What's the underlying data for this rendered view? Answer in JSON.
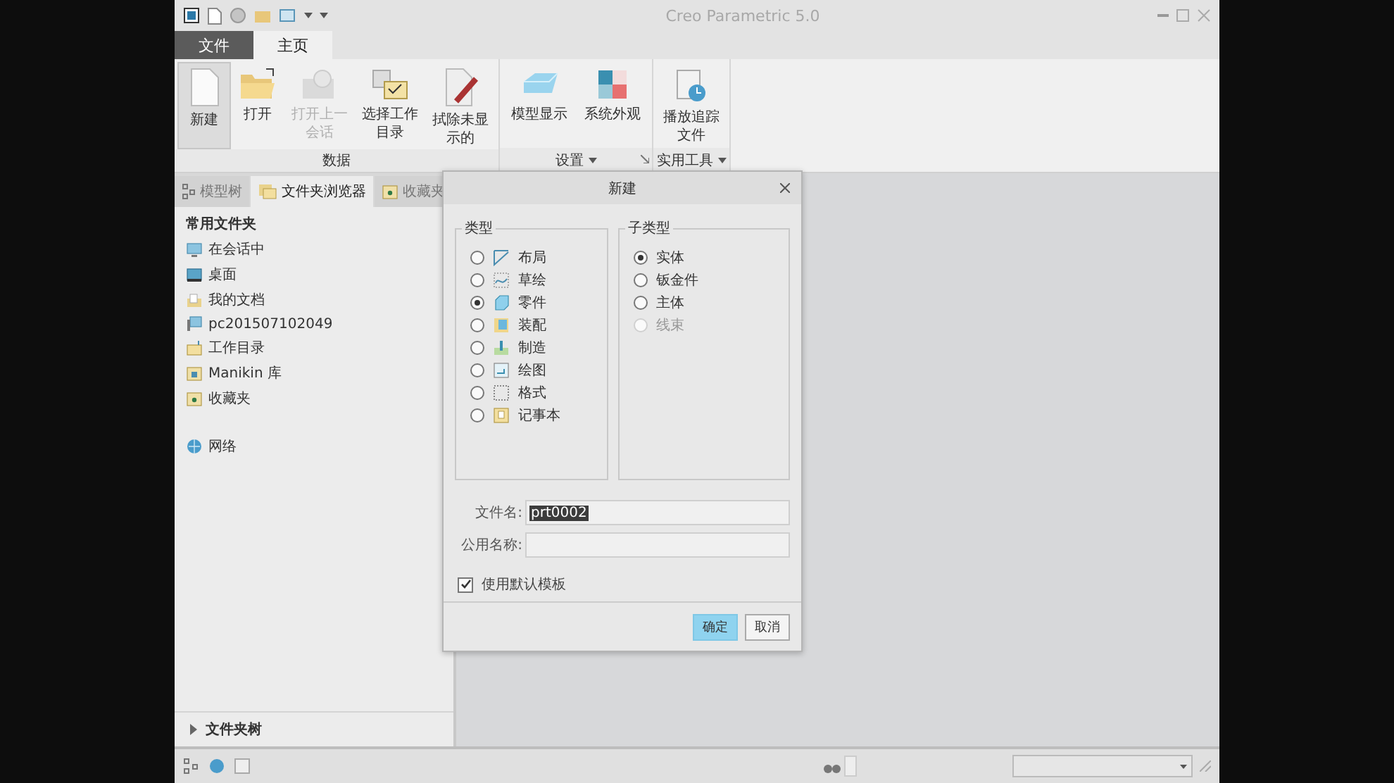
{
  "window": {
    "title": "Creo Parametric 5.0"
  },
  "ribbon_tabs": [
    {
      "label": "文件",
      "selected": false
    },
    {
      "label": "主页",
      "selected": true
    }
  ],
  "ribbon_groups": [
    {
      "label": "数据",
      "buttons": [
        {
          "label": "新建",
          "highlighted": true,
          "disabled": false
        },
        {
          "label": "打开",
          "highlighted": false,
          "disabled": false
        },
        {
          "label": "打开上一会话",
          "highlighted": false,
          "disabled": true
        },
        {
          "label": "选择工作目录",
          "highlighted": false,
          "disabled": false
        },
        {
          "label": "拭除未显示的",
          "highlighted": false,
          "disabled": false
        }
      ]
    },
    {
      "label": "设置",
      "buttons": [
        {
          "label": "模型显示",
          "highlighted": false,
          "disabled": false
        },
        {
          "label": "系统外观",
          "highlighted": false,
          "disabled": false
        }
      ]
    },
    {
      "label": "实用工具",
      "buttons": [
        {
          "label": "播放追踪文件",
          "highlighted": false,
          "disabled": false
        }
      ]
    }
  ],
  "navigator": {
    "tabs": [
      {
        "label": "模型树",
        "selected": false
      },
      {
        "label": "文件夹浏览器",
        "selected": true
      },
      {
        "label": "收藏夹",
        "selected": false
      }
    ],
    "header": "常用文件夹",
    "items": [
      {
        "label": "在会话中"
      },
      {
        "label": "桌面"
      },
      {
        "label": "我的文档"
      },
      {
        "label": "pc201507102049"
      },
      {
        "label": "工作目录"
      },
      {
        "label": "Manikin 库"
      },
      {
        "label": "收藏夹"
      },
      {
        "label": "网络"
      }
    ],
    "folder_tree": {
      "label": "文件夹树",
      "expanded": false
    }
  },
  "dialog": {
    "title": "新建",
    "type_group": {
      "label": "类型",
      "options": [
        {
          "label": "布局",
          "selected": false
        },
        {
          "label": "草绘",
          "selected": false
        },
        {
          "label": "零件",
          "selected": true
        },
        {
          "label": "装配",
          "selected": false
        },
        {
          "label": "制造",
          "selected": false
        },
        {
          "label": "绘图",
          "selected": false
        },
        {
          "label": "格式",
          "selected": false
        },
        {
          "label": "记事本",
          "selected": false
        }
      ]
    },
    "subtype_group": {
      "label": "子类型",
      "options": [
        {
          "label": "实体",
          "selected": true,
          "disabled": false
        },
        {
          "label": "钣金件",
          "selected": false,
          "disabled": false
        },
        {
          "label": "主体",
          "selected": false,
          "disabled": false
        },
        {
          "label": "线束",
          "selected": false,
          "disabled": true
        }
      ]
    },
    "fields": [
      {
        "label": "文件名:",
        "value": "prt0002",
        "value_selected": true
      },
      {
        "label": "公用名称:"
      }
    ],
    "use_default_template": {
      "label": "使用默认模板",
      "checked": true
    },
    "buttons": [
      {
        "label": "确定",
        "primary": true
      },
      {
        "label": "取消",
        "primary": false
      }
    ]
  }
}
